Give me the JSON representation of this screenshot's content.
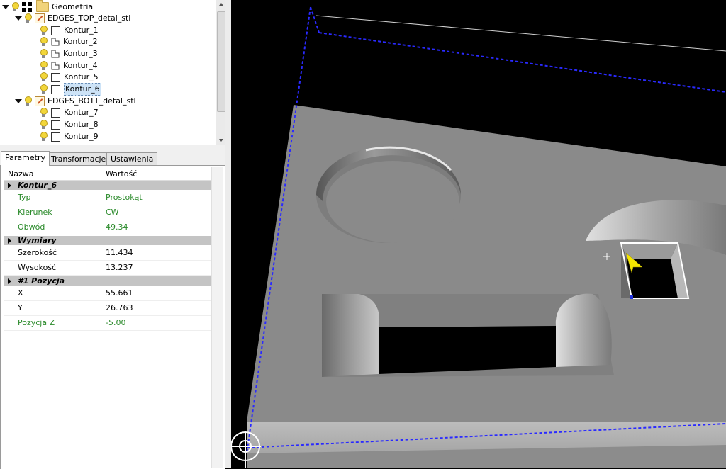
{
  "tree": {
    "root": {
      "label": "Geometria"
    },
    "groups": [
      {
        "label": "EDGES_TOP_detal_stl",
        "items": [
          {
            "label": "Kontur_1",
            "icon": "square"
          },
          {
            "label": "Kontur_2",
            "icon": "l-shape"
          },
          {
            "label": "Kontur_3",
            "icon": "l-shape"
          },
          {
            "label": "Kontur_4",
            "icon": "l-shape"
          },
          {
            "label": "Kontur_5",
            "icon": "square"
          },
          {
            "label": "Kontur_6",
            "icon": "square",
            "selected": true
          }
        ]
      },
      {
        "label": "EDGES_BOTT_detal_stl",
        "items": [
          {
            "label": "Kontur_7",
            "icon": "square"
          },
          {
            "label": "Kontur_8",
            "icon": "square"
          },
          {
            "label": "Kontur_9",
            "icon": "square"
          }
        ]
      }
    ]
  },
  "tabs": [
    {
      "label": "Parametry",
      "active": true
    },
    {
      "label": "Transformacje",
      "active": false
    },
    {
      "label": "Ustawienia",
      "active": false
    }
  ],
  "properties": {
    "col_name": "Nazwa",
    "col_value": "Wartość",
    "sections": [
      {
        "title": "Kontur_6",
        "rows": [
          {
            "name": "Typ",
            "value": "Prostokąt",
            "color": "green"
          },
          {
            "name": "Kierunek",
            "value": "CW",
            "color": "green"
          },
          {
            "name": "Obwód",
            "value": "49.34",
            "color": "green"
          }
        ]
      },
      {
        "title": "Wymiary",
        "rows": [
          {
            "name": "Szerokość",
            "value": "11.434",
            "color": "black"
          },
          {
            "name": "Wysokość",
            "value": "13.237",
            "color": "black"
          }
        ]
      },
      {
        "title": "#1 Pozycja",
        "rows": [
          {
            "name": "X",
            "value": "55.661",
            "color": "black"
          },
          {
            "name": "Y",
            "value": "26.763",
            "color": "black"
          },
          {
            "name": "Pozycja Z",
            "value": "-5.00",
            "color": "green"
          }
        ]
      }
    ]
  },
  "colors": {
    "viewport_bg": "#000000",
    "part_face": "#8a8a8a",
    "bbox_line": "#2a2aff",
    "selection_outline": "#ffffff",
    "cursor": "#f5e600",
    "green_text": "#2a8a2a"
  }
}
